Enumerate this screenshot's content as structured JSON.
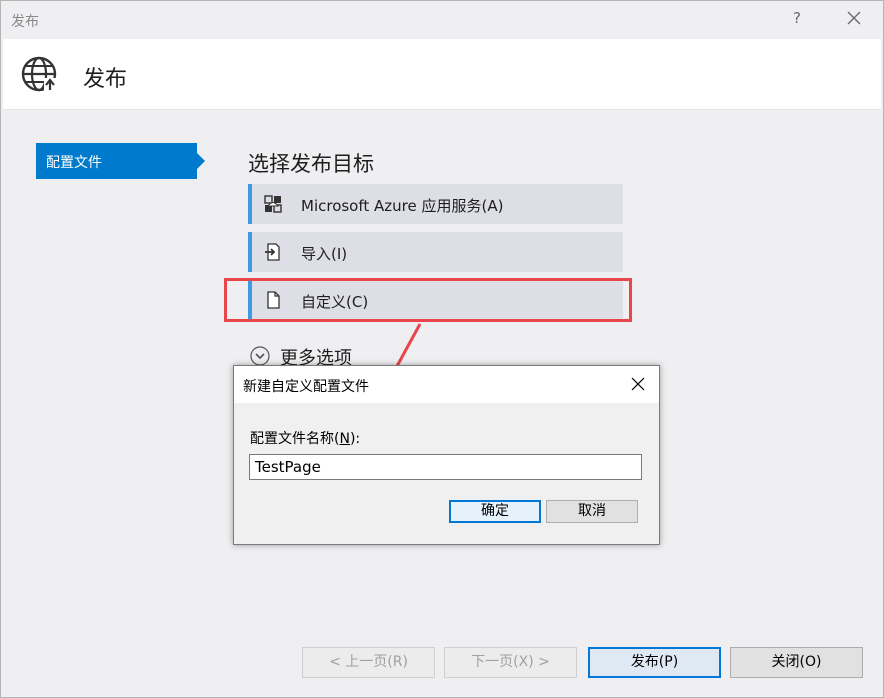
{
  "window": {
    "title": "发布",
    "help_glyph": "?"
  },
  "header": {
    "title": "发布",
    "icon": "globe-icon"
  },
  "sidebar": {
    "items": [
      {
        "label": "配置文件",
        "selected": true
      }
    ]
  },
  "main": {
    "section_title": "选择发布目标",
    "targets": [
      {
        "label": "Microsoft Azure 应用服务(A)",
        "icon": "azure-cloud-icon"
      },
      {
        "label": "导入(I)",
        "icon": "import-icon"
      },
      {
        "label": "自定义(C)",
        "icon": "document-icon",
        "highlighted": true
      }
    ],
    "more_options": "更多选项"
  },
  "dialog": {
    "title": "新建自定义配置文件",
    "field_label_prefix": "配置文件名称(",
    "field_label_mnemonic": "N",
    "field_label_suffix": "):",
    "field_value": "TestPage",
    "ok_label": "确定",
    "cancel_label": "取消"
  },
  "footer": {
    "prev_label": "< 上一页(R)",
    "next_label": "下一页(X) >",
    "publish_label": "发布(P)",
    "close_label": "关闭(O)"
  },
  "colors": {
    "accent": "#007acc",
    "highlight": "#e8454c",
    "target_bar": "#3f9ae0"
  }
}
